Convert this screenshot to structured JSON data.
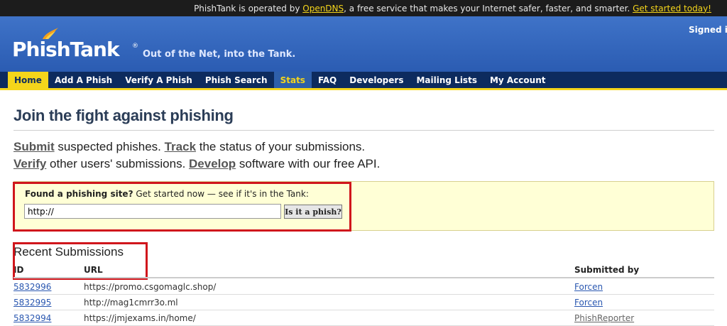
{
  "topbar": {
    "prefix": "PhishTank is operated by ",
    "link_opendns": "OpenDNS",
    "middle": ", a free service that makes your Internet safer, faster, and smarter. ",
    "link_started": "Get started today!"
  },
  "header": {
    "logo": "PhishTank",
    "registered": "®",
    "tagline": "Out of the Net, into the Tank.",
    "signed_in": "Signed i"
  },
  "nav": {
    "items": [
      {
        "label": "Home"
      },
      {
        "label": "Add A Phish"
      },
      {
        "label": "Verify A Phish"
      },
      {
        "label": "Phish Search"
      },
      {
        "label": "Stats"
      },
      {
        "label": "FAQ"
      },
      {
        "label": "Developers"
      },
      {
        "label": "Mailing Lists"
      },
      {
        "label": "My Account"
      }
    ]
  },
  "main": {
    "title": "Join the fight against phishing",
    "intro": {
      "submit": "Submit",
      "submit_rest": " suspected phishes. ",
      "track": "Track",
      "track_rest": " the status of your submissions.",
      "verify": "Verify",
      "verify_rest": " other users' submissions. ",
      "develop": "Develop",
      "develop_rest": " software with our free API."
    },
    "search": {
      "label_bold": "Found a phishing site?",
      "label_rest": " Get started now — see if it's in the Tank:",
      "input_value": "http://",
      "button": "Is it a phish?"
    },
    "recent": {
      "heading": "Recent Submissions",
      "columns": {
        "id": "ID",
        "url": "URL",
        "by": "Submitted by"
      },
      "rows": [
        {
          "id": "5832996",
          "url": "https://promo.csgomaglc.shop/",
          "by": "Forcen"
        },
        {
          "id": "5832995",
          "url": "http://mag1cmrr3o.ml",
          "by": "Forcen"
        },
        {
          "id": "5832994",
          "url": "https://jmjexams.in/home/",
          "by": "PhishReporter"
        }
      ]
    }
  },
  "colors": {
    "header_blue": "#2b5cb2",
    "nav_navy": "#0d2b5e",
    "accent_yellow": "#f4d51b",
    "highlight_red": "#d0161c"
  }
}
